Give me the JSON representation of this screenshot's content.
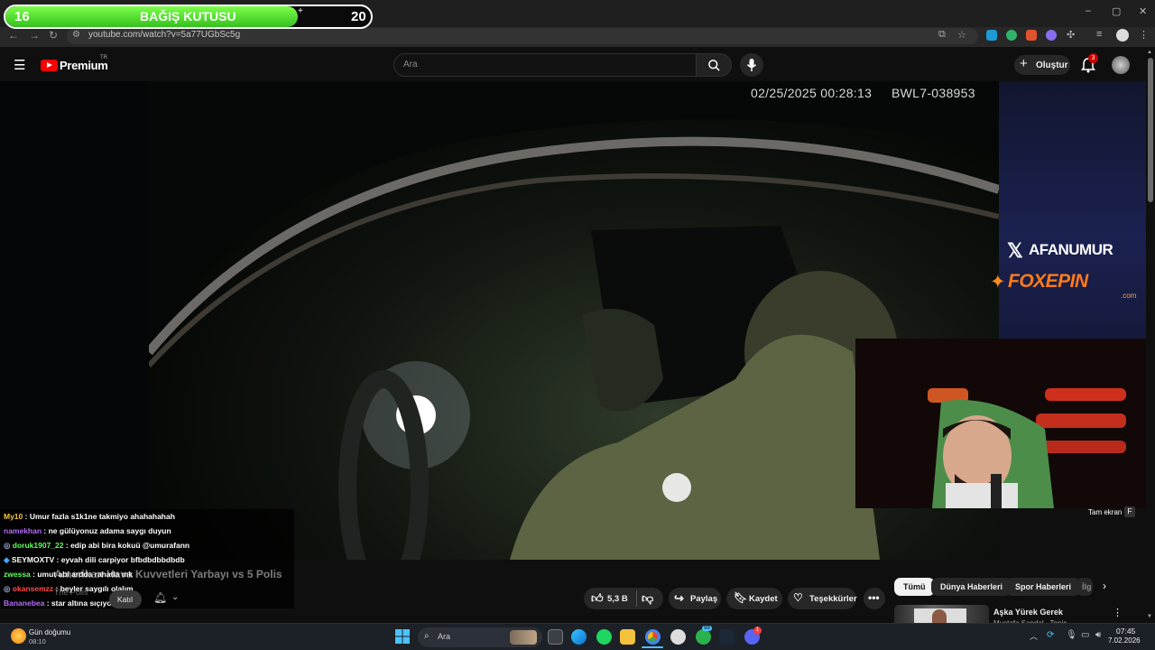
{
  "browser": {
    "url": "youtube.com/watch?v=5a77UGbSc5g",
    "window_controls": [
      "–",
      "▢",
      "✕"
    ]
  },
  "donation": {
    "current": "16",
    "title": "BAĞIŞ KUTUSU",
    "goal": "20",
    "progress": 0.8
  },
  "youtube": {
    "logo_text": "Premium",
    "region": "TR",
    "search_placeholder": "Ara",
    "create_label": "Oluştur",
    "notification_count": "3"
  },
  "video": {
    "timestamp": "02/25/2025 00:28:13",
    "device_id": "BWL7-038953",
    "fullscreen_tooltip": "Tam ekran",
    "fullscreen_key": "F",
    "title": "Amerikan Hava Kuvvetleri Yarbayı vs 5 Polis",
    "channel": "The Polis",
    "join_label": "Katıl",
    "like_count": "5,3 B",
    "share_label": "Paylaş",
    "save_label": "Kaydet",
    "thanks_label": "Teşekkürler"
  },
  "overlay": {
    "x_handle": "AFANUMUR",
    "sponsor": "FOXEPIN",
    "sponsor_tld": ".com"
  },
  "chat": [
    {
      "user": "My10",
      "text": ": Umur fazla s1k1ne takmiyo ahahahahah",
      "color": "#f5c542"
    },
    {
      "user": "namekhan",
      "text": ": ne gülüyonuz adama saygı duyun",
      "color": "#b56bff"
    },
    {
      "user": "doruk1907_22",
      "text": ": edip abi bira kokuü @umurafann",
      "color": "#5dff5d"
    },
    {
      "user": "SEYMOXTV",
      "text": ": eyvah dili carpiyor bfbdbdbbdbdb",
      "color": "#ffffff"
    },
    {
      "user": "zwessa",
      "text": ": umut abi ardda rahatla mk",
      "color": "#5dff5d"
    },
    {
      "user": "okansemzz",
      "text": ": beyler saygılı olalım",
      "color": "#ff4c4c"
    },
    {
      "user": "Bananebea",
      "text": ": star altına sıçıyor",
      "color": "#b56bff"
    }
  ],
  "chips": [
    "Tümü",
    "Dünya Haberleri",
    "Spor Haberleri",
    "İlg"
  ],
  "recommendation": {
    "title": "Aşka Yürek Gerek",
    "channel": "Mustafa Sandal - Topic"
  },
  "taskbar": {
    "weather_label": "Gün doğumu",
    "weather_time": "08:10",
    "search_placeholder": "Ara",
    "time": "07:45",
    "date": "7.02.2026",
    "badge_discord": "1",
    "badge_chat": "99"
  },
  "colors": {
    "donation_fill": "#4fe02a",
    "yt_red": "#ff0000",
    "accent_blue": "#3ea6ff"
  }
}
